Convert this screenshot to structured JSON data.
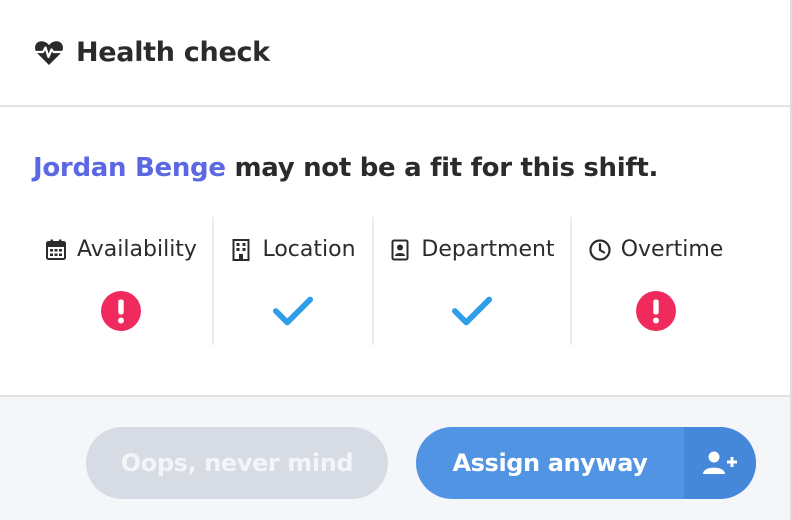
{
  "header": {
    "title": "Health check",
    "icon": "heartbeat-icon"
  },
  "message": {
    "employee_name": "Jordan Benge",
    "text": "may not be a fit for this shift."
  },
  "checks": [
    {
      "label": "Availability",
      "icon": "calendar-icon",
      "status": "warning"
    },
    {
      "label": "Location",
      "icon": "building-icon",
      "status": "ok"
    },
    {
      "label": "Department",
      "icon": "id-badge-icon",
      "status": "ok"
    },
    {
      "label": "Overtime",
      "icon": "clock-icon",
      "status": "warning"
    }
  ],
  "footer": {
    "cancel_label": "Oops, never mind",
    "assign_label": "Assign anyway",
    "assign_icon": "user-plus-icon"
  },
  "colors": {
    "accent_name": "#5b67e3",
    "ok": "#2f9ee8",
    "warning": "#f02a5c",
    "primary_button": "#5194e3",
    "disabled_button": "#d7dce4"
  }
}
